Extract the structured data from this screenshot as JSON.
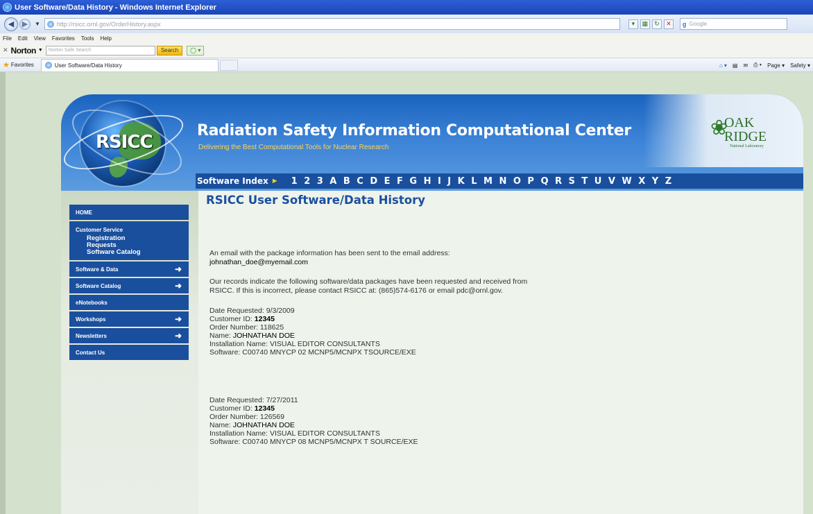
{
  "window": {
    "title": "User Software/Data History - Windows Internet Explorer"
  },
  "browser": {
    "address_host": "ornl.gov",
    "address_text": "http://rsicc.ornl.gov/OrderHistory.aspx",
    "search_placeholder": "Google",
    "menu": [
      "File",
      "Edit",
      "View",
      "Favorites",
      "Tools",
      "Help"
    ],
    "norton": {
      "brand": "Norton",
      "placeholder": "Norton Safe Search",
      "search_label": "Search"
    },
    "favorites_label": "Favorites",
    "tab_title": "User Software/Data History",
    "commands": [
      "Page ▾",
      "Safety ▾"
    ]
  },
  "site": {
    "logo_text": "RSICC",
    "title": "Radiation Safety Information Computational Center",
    "tagline": "Delivering the Best Computational Tools for Nuclear Research",
    "ornl": {
      "line1": "OAK",
      "line2": "RIDGE",
      "line3": "National Laboratory"
    },
    "index_label": "Software Index",
    "index_letters": [
      "1",
      "2",
      "3",
      "A",
      "B",
      "C",
      "D",
      "E",
      "F",
      "G",
      "H",
      "I",
      "J",
      "K",
      "L",
      "M",
      "N",
      "O",
      "P",
      "Q",
      "R",
      "S",
      "T",
      "U",
      "V",
      "W",
      "X",
      "Y",
      "Z"
    ]
  },
  "nav": {
    "home": "HOME",
    "customer_service": "Customer Service",
    "cs_links": [
      "Registration",
      "Requests",
      "Software Catalog"
    ],
    "items": [
      {
        "label": "Software & Data",
        "arrow": true
      },
      {
        "label": "Software Catalog",
        "arrow": true
      },
      {
        "label": "eNotebooks",
        "arrow": false
      },
      {
        "label": "Workshops",
        "arrow": true
      },
      {
        "label": "Newsletters",
        "arrow": true
      },
      {
        "label": "Contact Us",
        "arrow": false
      }
    ]
  },
  "content": {
    "heading": "RSICC User Software/Data History",
    "email_notice": "An email with the package information has been sent to the email address:",
    "email": "johnathan_doe@myemail.com",
    "records_notice_1": "Our records indicate the following software/data packages have been requested and received from",
    "records_notice_2": "RSICC. If this is incorrect, please contact RSICC at: (865)574-6176 or email pdc@ornl.gov.",
    "records": [
      {
        "date_requested": "Date Requested: 9/3/2009",
        "customer_id_label": "Customer ID:",
        "customer_id": "12345",
        "order_number": "Order Number: 118625",
        "name_label": "Name:",
        "name": "JOHNATHAN DOE",
        "installation": "Installation Name: VISUAL EDITOR CONSULTANTS",
        "software": "Software: C00740 MNYCP 02 MCNP5/MCNPX TSOURCE/EXE"
      },
      {
        "date_requested": "Date Requested: 7/27/2011",
        "customer_id_label": "Customer ID:",
        "customer_id": "12345",
        "order_number": "Order Number: 126569",
        "name_label": "Name:",
        "name": "JOHNATHAN DOE",
        "installation": "Installation Name: VISUAL EDITOR CONSULTANTS",
        "software": "Software: C00740 MNYCP 08 MCNP5/MCNPX T SOURCE/EXE"
      }
    ]
  }
}
